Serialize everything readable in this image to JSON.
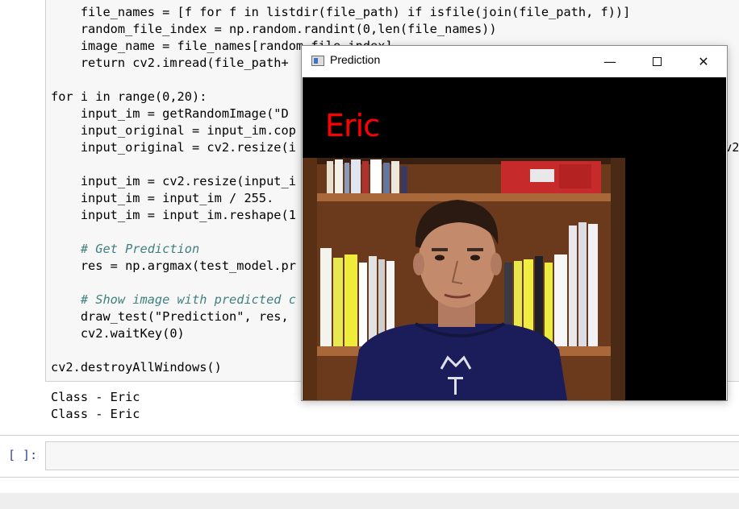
{
  "code_lines": [
    "    file_names = [f for f in listdir(file_path) if isfile(join(file_path, f))]",
    "    random_file_index = np.random.randint(0,len(file_names))",
    "    image_name = file_names[random_file_index]",
    "    return cv2.imread(file_path+",
    "for i in range(0,20):",
    "    input_im = getRandomImage(\"D",
    "    input_original = input_im.cop",
    "    input_original = cv2.resize(i",
    "    input_im = cv2.resize(input_i",
    "    input_im = input_im / 255.",
    "    input_im = input_im.reshape(1",
    "    # Get Prediction",
    "    res = np.argmax(test_model.pr",
    "    # Show image with predicted c",
    "    draw_test(\"Prediction\", res,",
    "    cv2.waitKey(0)",
    "cv2.destroyAllWindows()",
    "v2"
  ],
  "output_lines": [
    "Class - Eric",
    "Class - Eric"
  ],
  "empty_cell_prompt": "[ ]:",
  "window": {
    "title": "Prediction",
    "prediction_text": "Eric",
    "minimize_glyph": "—",
    "close_glyph": "✕"
  },
  "colors": {
    "keyword": "#008000",
    "string": "#ba2121",
    "comment": "#408080",
    "prediction_text": "#ff0000"
  }
}
